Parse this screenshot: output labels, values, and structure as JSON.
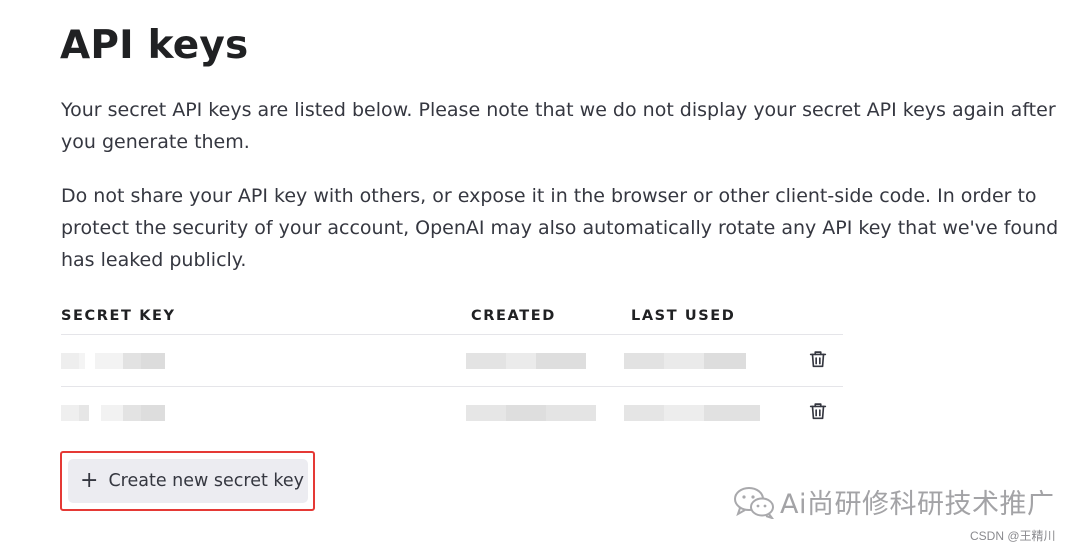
{
  "page": {
    "title": "API keys",
    "intro": "Your secret API keys are listed below. Please note that we do not display your secret API keys again after you generate them.",
    "warning": "Do not share your API key with others, or expose it in the browser or other client-side code. In order to protect the security of your account, OpenAI may also automatically rotate any API key that we've found has leaked publicly."
  },
  "table": {
    "headers": {
      "secret_key": "SECRET KEY",
      "created": "CREATED",
      "last_used": "LAST USED"
    },
    "rows": [
      {
        "secret_key": "",
        "created": "",
        "last_used": "",
        "delete_icon": "trash-icon"
      },
      {
        "secret_key": "",
        "created": "",
        "last_used": "",
        "delete_icon": "trash-icon"
      }
    ]
  },
  "actions": {
    "create_label": "Create new secret key",
    "create_icon": "plus-icon",
    "highlight_color": "#e53935"
  },
  "watermark": {
    "text": "Ai尚研修科研技术推广",
    "icon": "wechat-icon",
    "credit": "CSDN @王精川"
  }
}
